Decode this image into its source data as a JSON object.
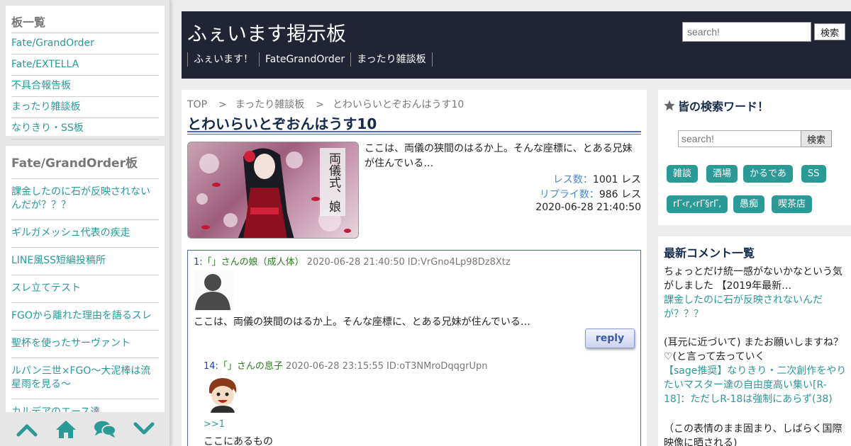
{
  "left": {
    "boards_title": "板一覧",
    "boards": [
      "Fate/GrandOrder",
      "Fate/EXTELLA",
      "不具合報告板",
      "まったり雑談板",
      "なりきり・SS板"
    ],
    "threads_title": "Fate/GrandOrder板",
    "threads": [
      "課金したのに石が反映されないんだが？？？",
      "ギルガメッシュ代表の疾走",
      "LINE風SS短編投稿所",
      "スレ立てテスト",
      "FGOから離れた理由を語るスレ",
      "聖杯を使ったサーヴァント",
      "ルパン三世×FGO～大泥棒は流星雨を見る～",
      "カルデアのエース達"
    ],
    "footer_icons": [
      "chevron-up-icon",
      "home-icon",
      "chat-bubbles-icon",
      "chevron-down-icon"
    ]
  },
  "header": {
    "title": "ふぇいます掲示板",
    "nav": [
      "ふぇいます！",
      "FateGrandOrder",
      "まったり雑談板"
    ],
    "search_placeholder": "search!",
    "search_button": "検索"
  },
  "main": {
    "breadcrumb": [
      "TOP",
      "まったり雑談板",
      "とわいらいとぞおんはうす10"
    ],
    "breadcrumb_sep": ">",
    "title": "とわいらいとぞおんはうす10",
    "thumb_text": "両儀式、娘",
    "description": "ここは、両儀の狭間のはるか上。そんな座標に、とある兄妹が住んでいる…",
    "res_label": "レス数：",
    "res_value": "1001 レス",
    "reply_label": "リプライ数：",
    "reply_value": "986 レス",
    "date": "2020-06-28 21:40:50",
    "post1": {
      "num": "1:",
      "name": "「」さんの娘（成人体）",
      "date": "2020-06-28 21:40:50",
      "id": "ID:VrGno4Lp98Dz8Xtz",
      "body": "ここは、両儀の狭間のはるか上。そんな座標に、とある兄妹が住んでいる…",
      "reply_label": "reply"
    },
    "post14": {
      "num": "14:",
      "name": "「」さんの息子",
      "date": "2020-06-28 23:15:55",
      "id": "ID:oT3NMroDqqgrUpn",
      "anchor": ">>1",
      "body": "ここにあるもの"
    }
  },
  "right": {
    "search_title": "皆の検索ワード！",
    "search_placeholder": "search!",
    "search_button": "検索",
    "tags": [
      "雑談",
      "酒場",
      "かるであ",
      "SS",
      "rΓ‹r,‹rΓ§rΓ,",
      "愚痴",
      "喫茶店"
    ],
    "comments_title": "最新コメント一覧",
    "comments": [
      {
        "text": "ちょっとだけ統一感がないかなという気がしました 【2019年最新…",
        "link": "課金したのに石が反映されないんだが？？？"
      },
      {
        "text": "(耳元に近づいて) またお願いしますね？♡(と言って去っていく",
        "link": "【sage推奨】なりきり・二次創作をやりたいマスター達の自由度高い集い[R-18]：ただしR-18は強制にあらず(38)"
      },
      {
        "text": "（この表情のまま固まり、しばらく国際映像に晒される)",
        "link": ""
      }
    ]
  },
  "colors": {
    "accent": "#2a9a97",
    "header_bg": "#212434",
    "title_rule": "#4a6bb5"
  }
}
